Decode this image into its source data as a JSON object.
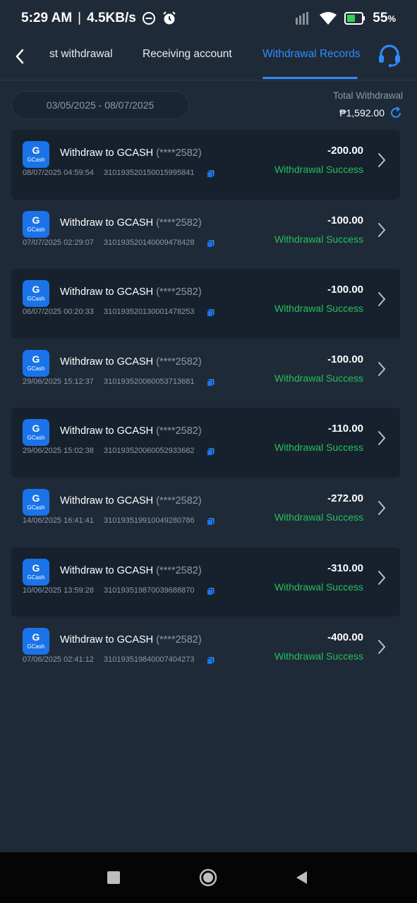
{
  "status_bar": {
    "time": "5:29 AM",
    "separator": "|",
    "speed": "4.5KB/s",
    "battery": "55",
    "battery_unit": "%"
  },
  "header": {
    "tabs": [
      {
        "label": "st withdrawal"
      },
      {
        "label": "Receiving account"
      },
      {
        "label": "Withdrawal Records"
      }
    ],
    "active_tab": 2
  },
  "filter": {
    "date_range": "03/05/2025 - 08/07/2025",
    "total_label": "Total Withdrawal",
    "total_value": "₱1,592.00"
  },
  "records": [
    {
      "title": "Withdraw to GCASH",
      "account": "(****2582)",
      "time": "08/07/2025 04:59:54",
      "order": "3101935201500159958 41",
      "amount": "-200.00",
      "status": "Withdrawal Success"
    },
    {
      "title": "Withdraw to GCASH",
      "account": "(****2582)",
      "time": "07/07/2025 02:29:07",
      "order": "310193520140009478428",
      "amount": "-100.00",
      "status": "Withdrawal Success"
    },
    {
      "title": "Withdraw to GCASH",
      "account": "(****2582)",
      "time": "06/07/2025 00:20:33",
      "order": "310193520130001478253",
      "amount": "-100.00",
      "status": "Withdrawal Success"
    },
    {
      "title": "Withdraw to GCASH",
      "account": "(****2582)",
      "time": "29/06/2025 15:12:37",
      "order": "310193520060053713681",
      "amount": "-100.00",
      "status": "Withdrawal Success"
    },
    {
      "title": "Withdraw to GCASH",
      "account": "(****2582)",
      "time": "29/06/2025 15:02:38",
      "order": "310193520060052933682",
      "amount": "-110.00",
      "status": "Withdrawal Success"
    },
    {
      "title": "Withdraw to GCASH",
      "account": "(****2582)",
      "time": "14/06/2025 16:41:41",
      "order": "310193519910049280786",
      "amount": "-272.00",
      "status": "Withdrawal Success"
    },
    {
      "title": "Withdraw to GCASH",
      "account": "(****2582)",
      "time": "10/06/2025 13:59:28",
      "order": "310193519870039688870",
      "amount": "-310.00",
      "status": "Withdrawal Success"
    },
    {
      "title": "Withdraw to GCASH",
      "account": "(****2582)",
      "time": "07/06/2025 02:41:12",
      "order": "310193519840007404273",
      "amount": "-400.00",
      "status": "Withdrawal Success"
    }
  ],
  "logo": {
    "text": "GCash",
    "glyph": "G"
  },
  "colors": {
    "background": "#1f2a38",
    "accent": "#2f8cff",
    "success": "#23c15b",
    "muted": "#8d99a8"
  },
  "icons": {
    "back": "chevron-left-icon",
    "support": "headset-icon",
    "refresh": "refresh-icon",
    "copy": "copy-icon",
    "row_chevron": "chevron-right-icon"
  }
}
